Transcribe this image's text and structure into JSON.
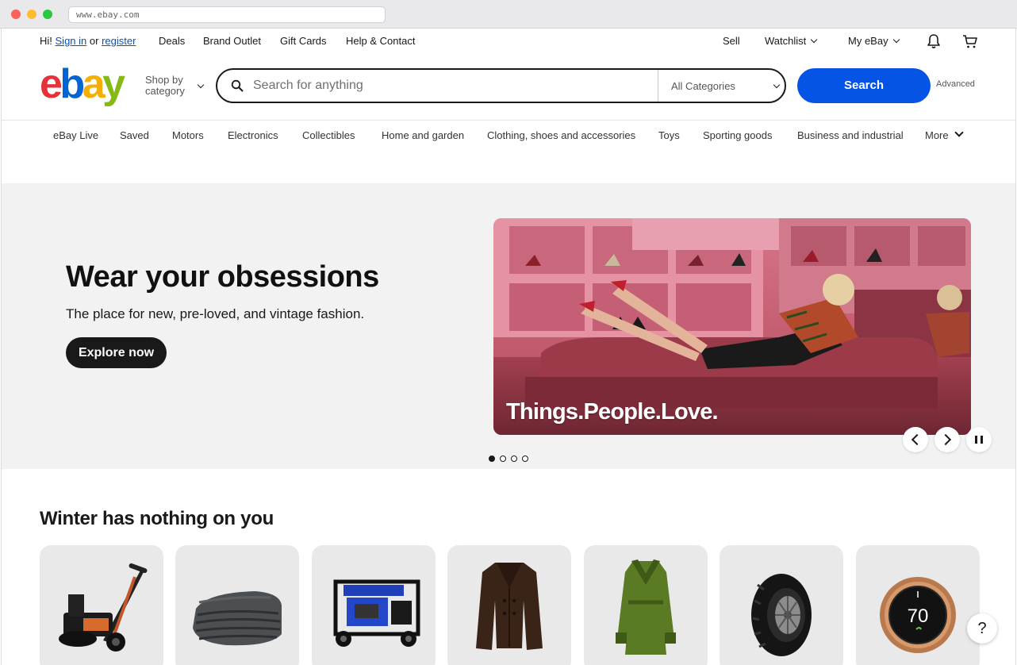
{
  "browser": {
    "url": "www.ebay.com"
  },
  "topbar": {
    "greeting": "Hi!",
    "sign_in": "Sign in",
    "or": "or",
    "register": "register",
    "links": [
      "Deals",
      "Brand Outlet",
      "Gift Cards",
      "Help & Contact"
    ],
    "sell": "Sell",
    "watchlist": "Watchlist",
    "my_ebay": "My eBay",
    "icons": [
      "bell-icon",
      "cart-icon"
    ]
  },
  "header": {
    "logo": {
      "e": "e",
      "b": "b",
      "a": "a",
      "y": "y"
    },
    "shop_by_line1": "Shop by",
    "shop_by_line2": "category",
    "search_placeholder": "Search for anything",
    "category_select": "All Categories",
    "search_button": "Search",
    "advanced": "Advanced"
  },
  "nav": [
    "eBay Live",
    "Saved",
    "Motors",
    "Electronics",
    "Collectibles",
    "Home and garden",
    "Clothing, shoes and accessories",
    "Toys",
    "Sporting goods",
    "Business and industrial",
    "More"
  ],
  "hero": {
    "title": "Wear your obsessions",
    "subtitle": "The place for new, pre-loved, and vintage fashion.",
    "cta": "Explore now",
    "image_caption": "Things.People.Love.",
    "slide_count": 4,
    "active_slide": 1
  },
  "section": {
    "title": "Winter has nothing on you",
    "tiles": [
      "snow-blower",
      "blanket",
      "generator",
      "leather-coat",
      "green-coat",
      "winter-tire",
      "thermostat"
    ],
    "thermostat_display": "70"
  },
  "help_button": "?",
  "colors": {
    "logo_e": "#e53238",
    "logo_b": "#0064d2",
    "logo_a": "#f5af02",
    "logo_y": "#86b817",
    "search_button": "#0654e6",
    "link": "#0654ba",
    "hero_bg": "#f2f2f2"
  }
}
